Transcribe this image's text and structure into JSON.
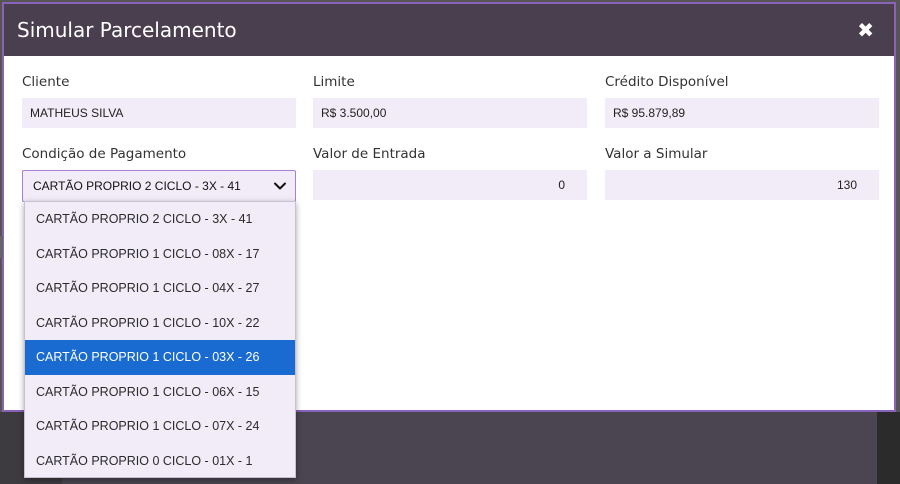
{
  "modal": {
    "title": "Simular Parcelamento",
    "close_label": "✖"
  },
  "fields": {
    "cliente": {
      "label": "Cliente",
      "value": "MATHEUS SILVA"
    },
    "limite": {
      "label": "Limite",
      "value": "R$ 3.500,00"
    },
    "credito": {
      "label": "Crédito Disponível",
      "value": "R$ 95.879,89"
    },
    "condicao": {
      "label": "Condição de Pagamento",
      "value": "CARTÃO PROPRIO 2 CICLO - 3X - 41"
    },
    "entrada": {
      "label": "Valor de Entrada",
      "value": "0"
    },
    "simular": {
      "label": "Valor a Simular",
      "value": "130"
    }
  },
  "dropdown": {
    "options": [
      "CARTÃO PROPRIO 2 CICLO - 3X - 41",
      "CARTÃO PROPRIO 1 CICLO - 08X - 17",
      "CARTÃO PROPRIO 1 CICLO - 04X - 27",
      "CARTÃO PROPRIO 1 CICLO - 10X - 22",
      "CARTÃO PROPRIO 1 CICLO - 03X - 26",
      "CARTÃO PROPRIO 1 CICLO - 06X - 15",
      "CARTÃO PROPRIO 1 CICLO - 07X - 24",
      "CARTÃO PROPRIO 0 CICLO - 01X - 1"
    ],
    "highlighted_index": 4
  },
  "colors": {
    "header": "#4a3f4f",
    "field_bg": "#f1ecf7",
    "accent_border": "#a97fd6",
    "highlight": "#1a6bd1"
  }
}
